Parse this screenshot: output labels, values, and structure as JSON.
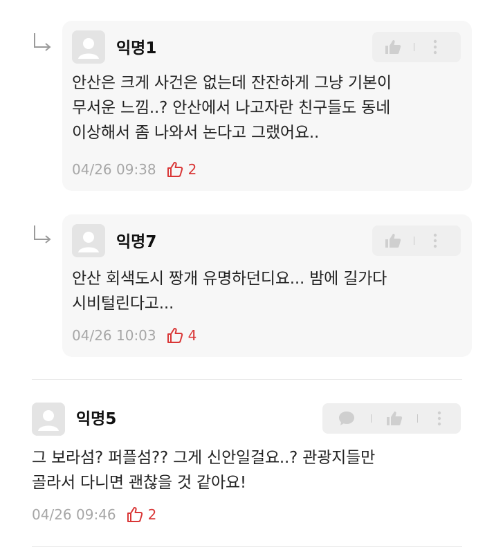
{
  "colors": {
    "card_bg": "#f7f7f7",
    "like_red": "#d93636",
    "meta_gray": "#a6a6a6",
    "icon_gray": "#cfcfcf"
  },
  "comments": [
    {
      "type": "reply",
      "author": "익명1",
      "text": "안산은 크게 사건은 없는데 잔잔하게 그냥 기본이\n무서운 느낌..? 안산에서 나고자란 친구들도 동네\n이상해서 좀 나와서 논다고 그랬어요..",
      "datetime": "04/26 09:38",
      "likes": "2",
      "actions": [
        "thumbs-up-icon",
        "more-vertical-icon"
      ]
    },
    {
      "type": "reply",
      "author": "익명7",
      "text": "안산 회색도시 짱개 유명하던디요... 밤에 길가다\n시비털린다고...",
      "datetime": "04/26 10:03",
      "likes": "4",
      "actions": [
        "thumbs-up-icon",
        "more-vertical-icon"
      ]
    },
    {
      "type": "comment",
      "author": "익명5",
      "text": "그 보라섬? 퍼플섬?? 그게 신안일걸요..? 관광지들만\n골라서 다니면 괜찮을 것 같아요!",
      "datetime": "04/26 09:46",
      "likes": "2",
      "actions": [
        "chat-bubble-icon",
        "thumbs-up-icon",
        "more-vertical-icon"
      ]
    }
  ]
}
